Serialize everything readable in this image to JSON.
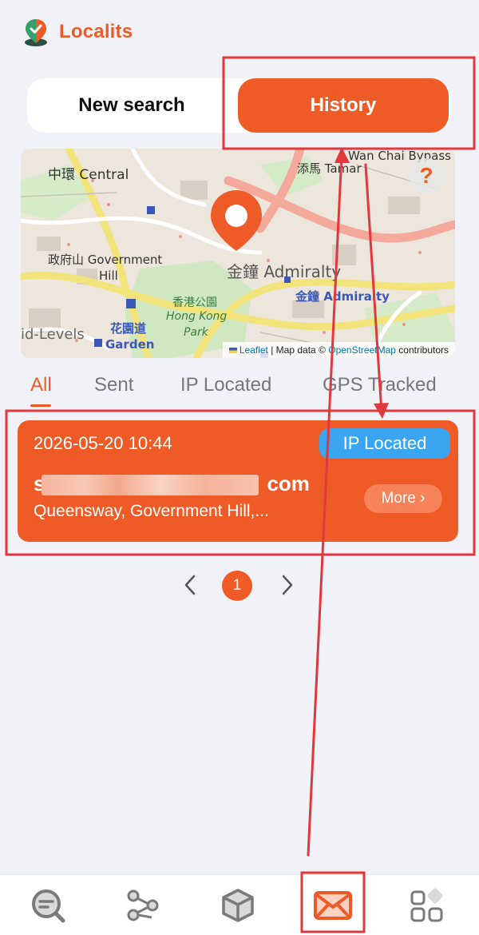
{
  "app": {
    "brand": "Localits"
  },
  "segment": {
    "new_search": "New search",
    "history": "History"
  },
  "map": {
    "labels": {
      "central": "中環 Central",
      "government_hill_1": "政府山 Government",
      "government_hill_2": "Hill",
      "admiralty": "金鐘 Admiralty",
      "admiralty_station": "金鐘 Admiralty",
      "hk_park_1": "香港公園",
      "hk_park_2": "Hong Kong",
      "hk_park_3": "Park",
      "garden_1": "花園道",
      "garden_2": "Garden",
      "mid_levels": "id-Levels",
      "wan_chai": "Wan Chai Bypass",
      "tamar": "添馬 Tamar"
    },
    "help": "?",
    "attribution": {
      "leaflet": "Leaflet",
      "mapdata": "| Map data ©",
      "osm": "OpenStreetMap",
      "contributors": "contributors"
    }
  },
  "tabs": {
    "all": "All",
    "sent": "Sent",
    "ip_located": "IP Located",
    "gps_tracked": "GPS Tracked"
  },
  "card": {
    "datetime": "2026-05-20 10:44",
    "badge": "IP Located",
    "email_suffix": "com",
    "email_prefix": "s",
    "address": "Queensway, Government Hill,...",
    "more": "More ›"
  },
  "pagination": {
    "current": "1"
  },
  "colors": {
    "accent": "#ef5b26",
    "badge": "#3aa5f0",
    "annotation": "#e2373c"
  },
  "icons": {
    "logo": "map-pin-check-icon",
    "nav": [
      "search-list-icon",
      "share-nodes-icon",
      "cube-icon",
      "mail-icon",
      "apps-grid-icon"
    ]
  }
}
